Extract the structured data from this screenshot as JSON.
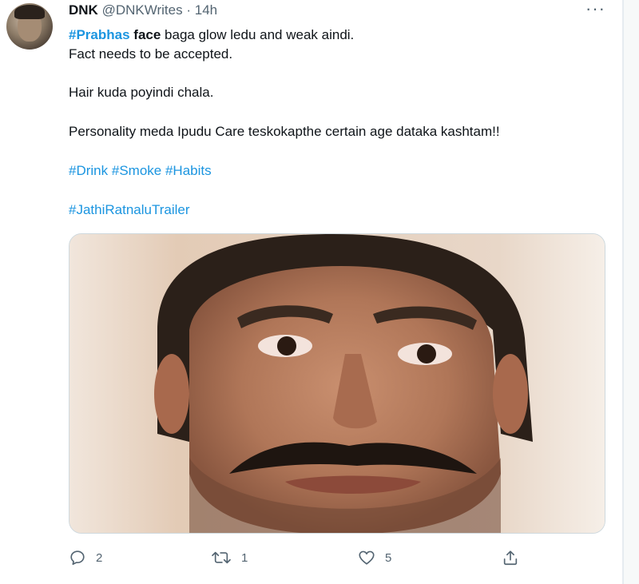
{
  "tweet": {
    "author_name": "DNK",
    "author_handle": "@DNKWrites",
    "separator": "·",
    "time": "14h",
    "more_icon": "more-icon",
    "lines": {
      "l1_tag": "#Prabhas",
      "l1_bold": "face",
      "l1_rest": "baga glow ledu and weak aindi.",
      "l2": "Fact needs to be accepted.",
      "l3": "Hair kuda poyindi chala.",
      "l4": "Personality meda Ipudu Care teskokapthe certain age dataka kashtam!!",
      "tag_drink": "#Drink",
      "tag_smoke": "#Smoke",
      "tag_habits": "#Habits",
      "tag_trailer": "#JathiRatnaluTrailer"
    },
    "colors": {
      "link": "#1b95e0",
      "muted": "#536471"
    }
  },
  "actions": {
    "reply": {
      "icon": "reply-icon",
      "count": "2"
    },
    "retweet": {
      "icon": "retweet-icon",
      "count": "1"
    },
    "like": {
      "icon": "heart-icon",
      "count": "5"
    },
    "share": {
      "icon": "share-icon"
    }
  }
}
